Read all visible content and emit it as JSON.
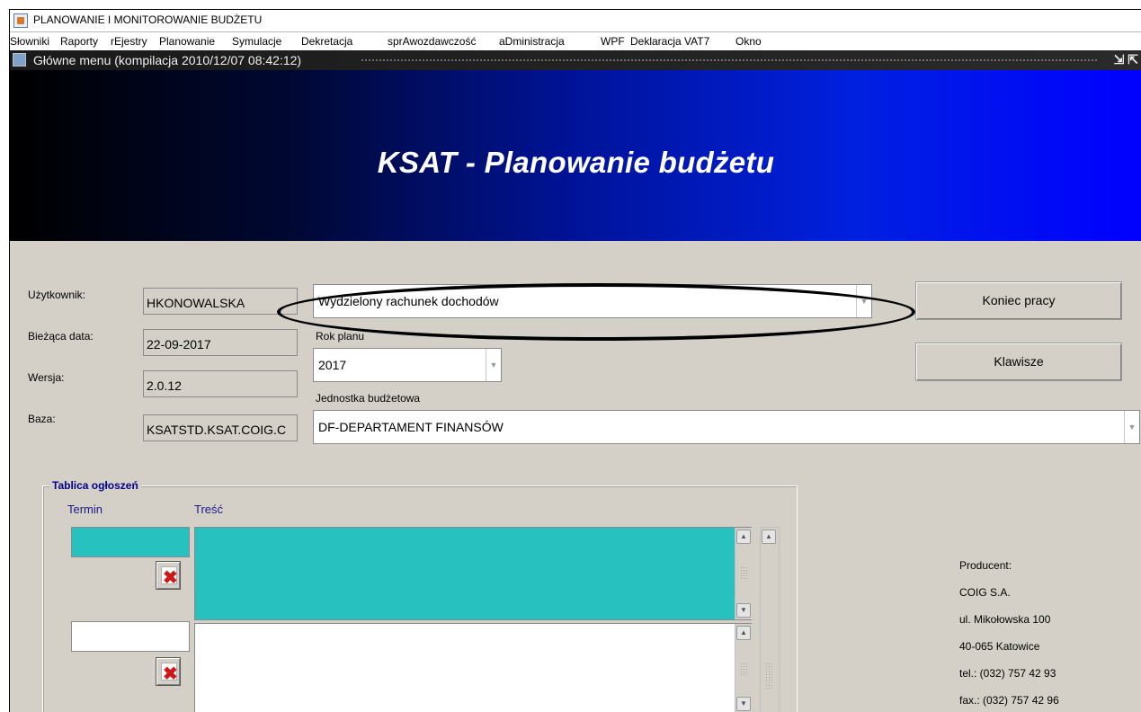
{
  "window": {
    "title": "PLANOWANIE I MONITOROWANIE BUDŻETU"
  },
  "menu": {
    "items": [
      "Słowniki",
      "Raporty",
      "rEjestry",
      "Planowanie",
      "Symulacje",
      "Dekretacja",
      "sprAwozdawczość",
      "aDministracja",
      "WPF",
      "Deklaracja VAT7",
      "Okno"
    ]
  },
  "inner_window": {
    "title": "Główne menu (kompilacja 2010/12/07 08:42:12)",
    "controls": "⇲ ⇱"
  },
  "banner": {
    "title": "KSAT - Planowanie budżetu"
  },
  "form": {
    "user_label": "Użytkownik:",
    "user_value": "HKONOWALSKA",
    "date_label": "Bieżąca data:",
    "date_value": "22-09-2017",
    "version_label": "Wersja:",
    "version_value": "2.0.12",
    "db_label": "Baza:",
    "db_value": "KSATSTD.KSAT.COIG.C",
    "account_value": "Wydzielony rachunek dochodów",
    "year_label": "Rok planu",
    "year_value": "2017",
    "unit_label": "Jednostka budżetowa",
    "unit_value": "DF-DEPARTAMENT FINANSÓW"
  },
  "buttons": {
    "end_work": "Koniec pracy",
    "keys": "Klawisze"
  },
  "board": {
    "title": "Tablica ogłoszeń",
    "col_term": "Termin",
    "col_content": "Treść"
  },
  "producer": {
    "label": "Producent:",
    "name": "COIG S.A.",
    "street": "ul. Mikołowska 100",
    "city": "40-065 Katowice",
    "tel": "tel.: (032) 757 42 93",
    "fax": "fax.: (032) 757 42 96"
  },
  "colors": {
    "banner_start": "#000000",
    "banner_end": "#0000ff",
    "teal": "#27c2bf",
    "annotation": "#000000"
  }
}
